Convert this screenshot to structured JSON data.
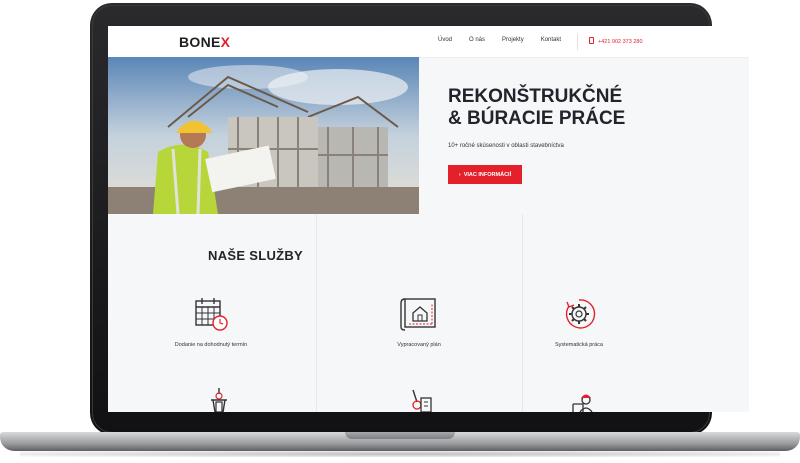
{
  "brand": {
    "logo_main": "BONE",
    "logo_accent": "X",
    "accent_color": "#e4212b"
  },
  "nav": {
    "items": [
      {
        "label": "Úvod"
      },
      {
        "label": "O nás"
      },
      {
        "label": "Projekty"
      },
      {
        "label": "Kontakt"
      }
    ],
    "phone": "+421 902 373 280",
    "phone_icon": "phone-icon"
  },
  "hero": {
    "title_line1": "REKONŠTRUKČNÉ",
    "title_line2": "& BÚRACIE PRÁCE",
    "subtitle": "10+ ročné skúsenosti v oblasti stavebníctva",
    "cta_label": "VIAC INFORMÁCIÍ",
    "image": "construction-worker-photo"
  },
  "services": {
    "title": "NAŠE SLUŽBY",
    "items": [
      {
        "label": "Dodanie na dohodnutý termín",
        "icon": "calendar-clock-icon"
      },
      {
        "label": "Vypracovaný plán",
        "icon": "blueprint-icon"
      },
      {
        "label": "Systematická práca",
        "icon": "gear-cycle-icon"
      },
      {
        "label": "",
        "icon": "jackhammer-icon"
      },
      {
        "label": "",
        "icon": "demolition-icon"
      },
      {
        "label": "",
        "icon": "engineer-icon"
      }
    ]
  }
}
